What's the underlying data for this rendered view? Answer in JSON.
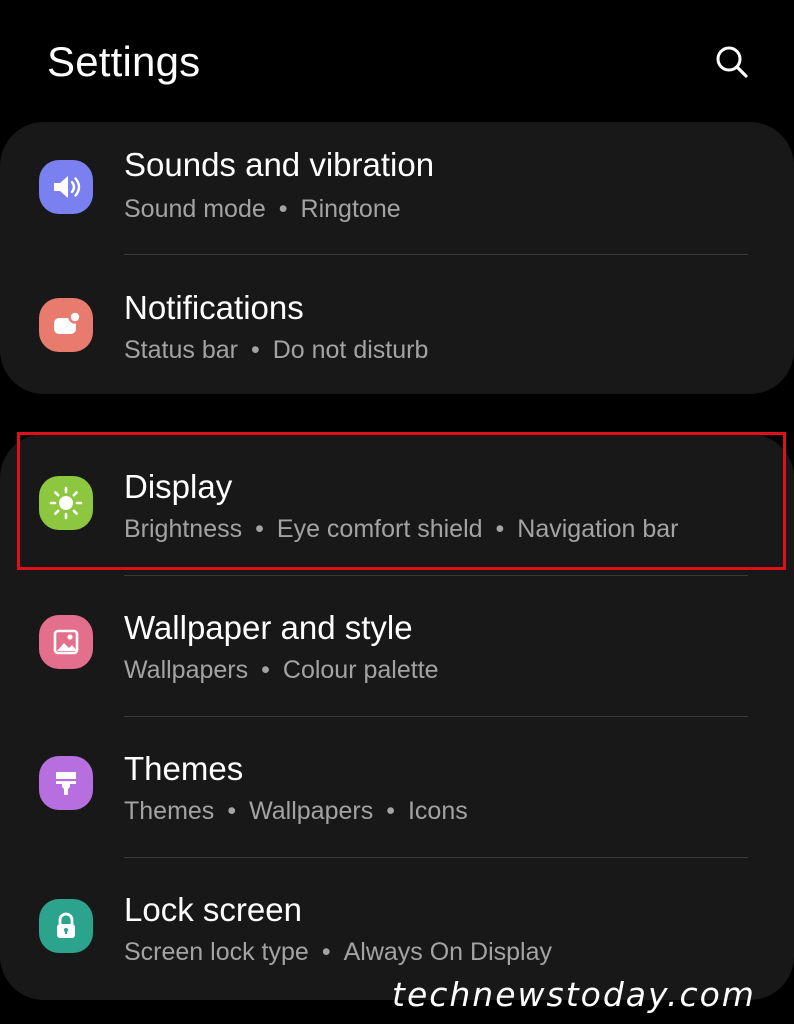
{
  "header": {
    "title": "Settings",
    "search_icon": "search-icon"
  },
  "groups": [
    {
      "items": [
        {
          "label": "Sounds and vibration",
          "sub": [
            "Sound mode",
            "Ringtone"
          ],
          "icon": "speaker-icon",
          "color": "#7b80f0"
        },
        {
          "label": "Notifications",
          "sub": [
            "Status bar",
            "Do not disturb"
          ],
          "icon": "notification-icon",
          "color": "#e97a6e"
        }
      ]
    },
    {
      "items": [
        {
          "label": "Display",
          "sub": [
            "Brightness",
            "Eye comfort shield",
            "Navigation bar"
          ],
          "icon": "sun-icon",
          "color": "#8dc63f",
          "highlighted": true
        },
        {
          "label": "Wallpaper and style",
          "sub": [
            "Wallpapers",
            "Colour palette"
          ],
          "icon": "image-icon",
          "color": "#e46f8c"
        },
        {
          "label": "Themes",
          "sub": [
            "Themes",
            "Wallpapers",
            "Icons"
          ],
          "icon": "brush-icon",
          "color": "#b76fe0"
        },
        {
          "label": "Lock screen",
          "sub": [
            "Screen lock type",
            "Always On Display"
          ],
          "icon": "lock-icon",
          "color": "#2ca38c"
        }
      ]
    }
  ],
  "highlight_color": "#e0101a",
  "watermark": "technewstoday.com"
}
